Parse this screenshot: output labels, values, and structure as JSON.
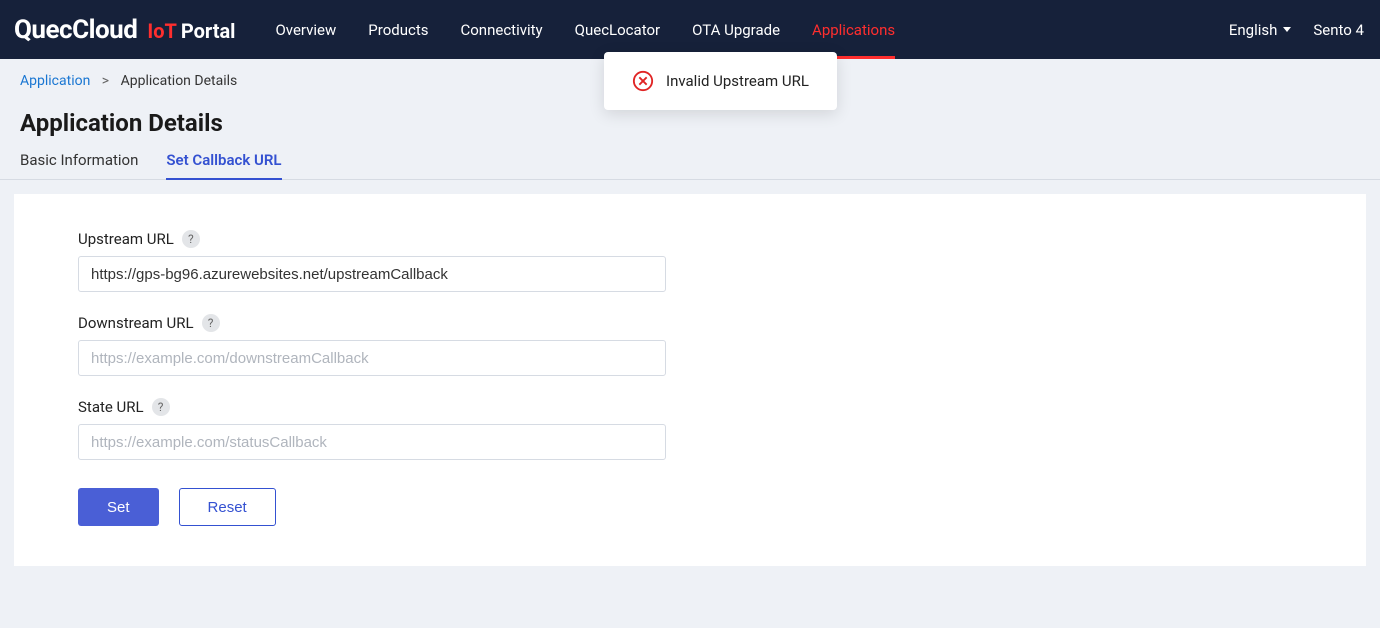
{
  "logo": {
    "main": "QuecCloud",
    "iot": "IoT",
    "portal": "Portal"
  },
  "nav": {
    "items": [
      {
        "label": "Overview",
        "active": false
      },
      {
        "label": "Products",
        "active": false
      },
      {
        "label": "Connectivity",
        "active": false
      },
      {
        "label": "QuecLocator",
        "active": false
      },
      {
        "label": "OTA Upgrade",
        "active": false
      },
      {
        "label": "Applications",
        "active": true
      }
    ]
  },
  "header": {
    "language": "English",
    "user": "Sento 4"
  },
  "breadcrumb": {
    "root": "Application",
    "current": "Application Details"
  },
  "page": {
    "title": "Application Details"
  },
  "tabs": {
    "items": [
      {
        "label": "Basic Information",
        "active": false
      },
      {
        "label": "Set Callback URL",
        "active": true
      }
    ]
  },
  "form": {
    "upstream": {
      "label": "Upstream URL",
      "value": "https://gps-bg96.azurewebsites.net/upstreamCallback"
    },
    "downstream": {
      "label": "Downstream URL",
      "placeholder": "https://example.com/downstreamCallback"
    },
    "state": {
      "label": "State URL",
      "placeholder": "https://example.com/statusCallback"
    }
  },
  "buttons": {
    "set": "Set",
    "reset": "Reset"
  },
  "toast": {
    "message": "Invalid Upstream URL"
  },
  "help_glyph": "?"
}
